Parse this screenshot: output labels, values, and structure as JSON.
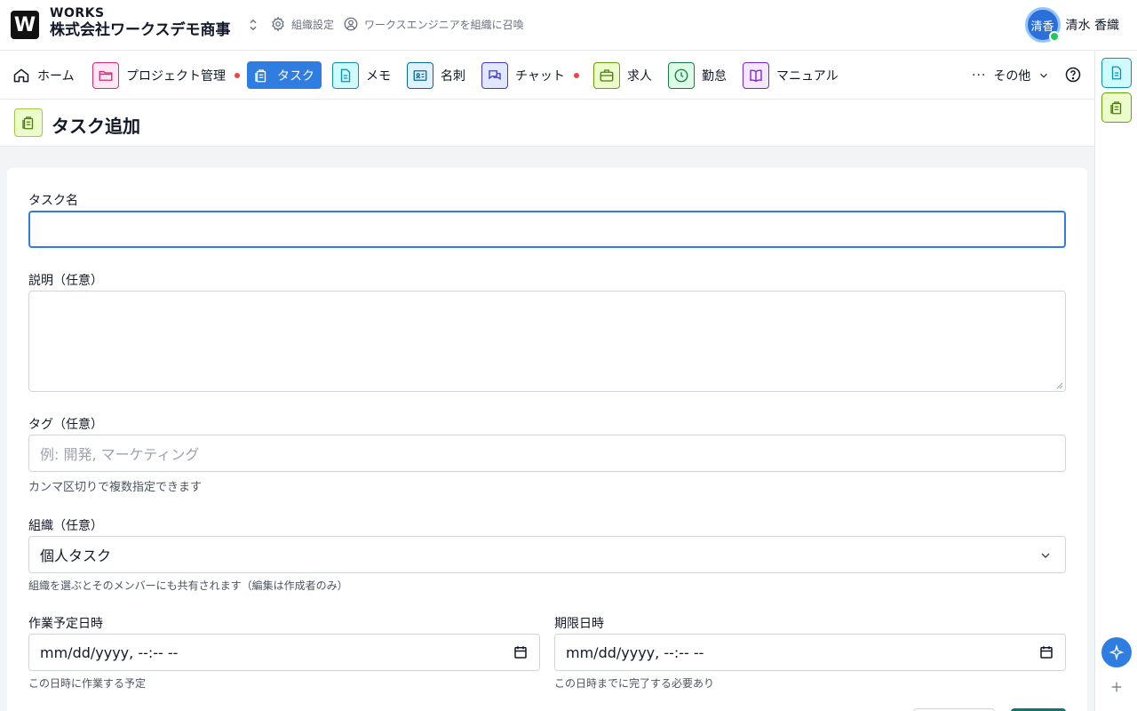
{
  "header": {
    "logo_letter": "W",
    "brand_top": "WORKS",
    "org_name": "株式会社ワークスデモ商事",
    "org_settings": "組織設定",
    "invite": "ワークスエンジニアを組織に召喚",
    "user_initials": "清香",
    "user_name": "清水 香織"
  },
  "nav": {
    "items": [
      {
        "label": "ホーム",
        "icon": "home-icon"
      },
      {
        "label": "プロジェクト管理",
        "icon": "folder-icon",
        "badge": true
      },
      {
        "label": "タスク",
        "icon": "clipboard-icon",
        "active": true
      },
      {
        "label": "メモ",
        "icon": "document-icon"
      },
      {
        "label": "名刺",
        "icon": "id-card-icon"
      },
      {
        "label": "チャット",
        "icon": "chat-icon",
        "badge": true
      },
      {
        "label": "求人",
        "icon": "briefcase-icon"
      },
      {
        "label": "勤怠",
        "icon": "clock-icon"
      },
      {
        "label": "マニュアル",
        "icon": "book-icon"
      }
    ],
    "more_label": "その他"
  },
  "page": {
    "title": "タスク追加"
  },
  "form": {
    "task_name_label": "タスク名",
    "task_name_value": "",
    "description_label": "説明（任意）",
    "tags_label": "タグ（任意）",
    "tags_placeholder": "例: 開発, マーケティング",
    "tags_help": "カンマ区切りで複数指定できます",
    "org_label": "組織（任意）",
    "org_value": "個人タスク",
    "org_help": "組織を選ぶとそのメンバーにも共有されます（編集は作成者のみ）",
    "scheduled_label": "作業予定日時",
    "scheduled_value": "mm/dd/yyyy, --:-- --",
    "scheduled_help": "この日時に作業する予定",
    "deadline_label": "期限日時",
    "deadline_value": "mm/dd/yyyy, --:-- --",
    "deadline_help": "この日時までに完了する必要あり"
  },
  "colors": {
    "accent": "#2f7de1",
    "badge": "#ef4444",
    "online": "#22c55e"
  }
}
